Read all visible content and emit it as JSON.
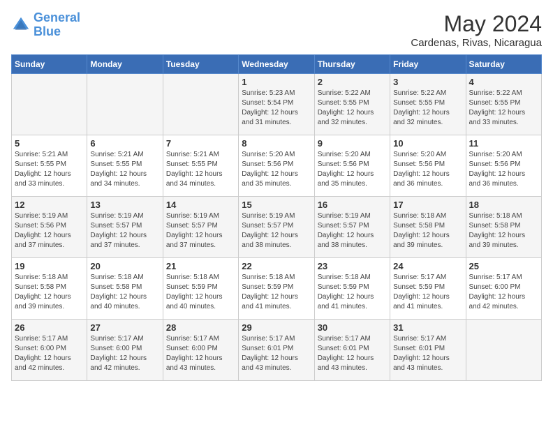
{
  "header": {
    "logo_general": "General",
    "logo_blue": "Blue",
    "month": "May 2024",
    "location": "Cardenas, Rivas, Nicaragua"
  },
  "weekdays": [
    "Sunday",
    "Monday",
    "Tuesday",
    "Wednesday",
    "Thursday",
    "Friday",
    "Saturday"
  ],
  "weeks": [
    [
      {
        "day": "",
        "sunrise": "",
        "sunset": "",
        "daylight": ""
      },
      {
        "day": "",
        "sunrise": "",
        "sunset": "",
        "daylight": ""
      },
      {
        "day": "",
        "sunrise": "",
        "sunset": "",
        "daylight": ""
      },
      {
        "day": "1",
        "sunrise": "Sunrise: 5:23 AM",
        "sunset": "Sunset: 5:54 PM",
        "daylight": "Daylight: 12 hours and 31 minutes."
      },
      {
        "day": "2",
        "sunrise": "Sunrise: 5:22 AM",
        "sunset": "Sunset: 5:55 PM",
        "daylight": "Daylight: 12 hours and 32 minutes."
      },
      {
        "day": "3",
        "sunrise": "Sunrise: 5:22 AM",
        "sunset": "Sunset: 5:55 PM",
        "daylight": "Daylight: 12 hours and 32 minutes."
      },
      {
        "day": "4",
        "sunrise": "Sunrise: 5:22 AM",
        "sunset": "Sunset: 5:55 PM",
        "daylight": "Daylight: 12 hours and 33 minutes."
      }
    ],
    [
      {
        "day": "5",
        "sunrise": "Sunrise: 5:21 AM",
        "sunset": "Sunset: 5:55 PM",
        "daylight": "Daylight: 12 hours and 33 minutes."
      },
      {
        "day": "6",
        "sunrise": "Sunrise: 5:21 AM",
        "sunset": "Sunset: 5:55 PM",
        "daylight": "Daylight: 12 hours and 34 minutes."
      },
      {
        "day": "7",
        "sunrise": "Sunrise: 5:21 AM",
        "sunset": "Sunset: 5:55 PM",
        "daylight": "Daylight: 12 hours and 34 minutes."
      },
      {
        "day": "8",
        "sunrise": "Sunrise: 5:20 AM",
        "sunset": "Sunset: 5:56 PM",
        "daylight": "Daylight: 12 hours and 35 minutes."
      },
      {
        "day": "9",
        "sunrise": "Sunrise: 5:20 AM",
        "sunset": "Sunset: 5:56 PM",
        "daylight": "Daylight: 12 hours and 35 minutes."
      },
      {
        "day": "10",
        "sunrise": "Sunrise: 5:20 AM",
        "sunset": "Sunset: 5:56 PM",
        "daylight": "Daylight: 12 hours and 36 minutes."
      },
      {
        "day": "11",
        "sunrise": "Sunrise: 5:20 AM",
        "sunset": "Sunset: 5:56 PM",
        "daylight": "Daylight: 12 hours and 36 minutes."
      }
    ],
    [
      {
        "day": "12",
        "sunrise": "Sunrise: 5:19 AM",
        "sunset": "Sunset: 5:56 PM",
        "daylight": "Daylight: 12 hours and 37 minutes."
      },
      {
        "day": "13",
        "sunrise": "Sunrise: 5:19 AM",
        "sunset": "Sunset: 5:57 PM",
        "daylight": "Daylight: 12 hours and 37 minutes."
      },
      {
        "day": "14",
        "sunrise": "Sunrise: 5:19 AM",
        "sunset": "Sunset: 5:57 PM",
        "daylight": "Daylight: 12 hours and 37 minutes."
      },
      {
        "day": "15",
        "sunrise": "Sunrise: 5:19 AM",
        "sunset": "Sunset: 5:57 PM",
        "daylight": "Daylight: 12 hours and 38 minutes."
      },
      {
        "day": "16",
        "sunrise": "Sunrise: 5:19 AM",
        "sunset": "Sunset: 5:57 PM",
        "daylight": "Daylight: 12 hours and 38 minutes."
      },
      {
        "day": "17",
        "sunrise": "Sunrise: 5:18 AM",
        "sunset": "Sunset: 5:58 PM",
        "daylight": "Daylight: 12 hours and 39 minutes."
      },
      {
        "day": "18",
        "sunrise": "Sunrise: 5:18 AM",
        "sunset": "Sunset: 5:58 PM",
        "daylight": "Daylight: 12 hours and 39 minutes."
      }
    ],
    [
      {
        "day": "19",
        "sunrise": "Sunrise: 5:18 AM",
        "sunset": "Sunset: 5:58 PM",
        "daylight": "Daylight: 12 hours and 39 minutes."
      },
      {
        "day": "20",
        "sunrise": "Sunrise: 5:18 AM",
        "sunset": "Sunset: 5:58 PM",
        "daylight": "Daylight: 12 hours and 40 minutes."
      },
      {
        "day": "21",
        "sunrise": "Sunrise: 5:18 AM",
        "sunset": "Sunset: 5:59 PM",
        "daylight": "Daylight: 12 hours and 40 minutes."
      },
      {
        "day": "22",
        "sunrise": "Sunrise: 5:18 AM",
        "sunset": "Sunset: 5:59 PM",
        "daylight": "Daylight: 12 hours and 41 minutes."
      },
      {
        "day": "23",
        "sunrise": "Sunrise: 5:18 AM",
        "sunset": "Sunset: 5:59 PM",
        "daylight": "Daylight: 12 hours and 41 minutes."
      },
      {
        "day": "24",
        "sunrise": "Sunrise: 5:17 AM",
        "sunset": "Sunset: 5:59 PM",
        "daylight": "Daylight: 12 hours and 41 minutes."
      },
      {
        "day": "25",
        "sunrise": "Sunrise: 5:17 AM",
        "sunset": "Sunset: 6:00 PM",
        "daylight": "Daylight: 12 hours and 42 minutes."
      }
    ],
    [
      {
        "day": "26",
        "sunrise": "Sunrise: 5:17 AM",
        "sunset": "Sunset: 6:00 PM",
        "daylight": "Daylight: 12 hours and 42 minutes."
      },
      {
        "day": "27",
        "sunrise": "Sunrise: 5:17 AM",
        "sunset": "Sunset: 6:00 PM",
        "daylight": "Daylight: 12 hours and 42 minutes."
      },
      {
        "day": "28",
        "sunrise": "Sunrise: 5:17 AM",
        "sunset": "Sunset: 6:00 PM",
        "daylight": "Daylight: 12 hours and 43 minutes."
      },
      {
        "day": "29",
        "sunrise": "Sunrise: 5:17 AM",
        "sunset": "Sunset: 6:01 PM",
        "daylight": "Daylight: 12 hours and 43 minutes."
      },
      {
        "day": "30",
        "sunrise": "Sunrise: 5:17 AM",
        "sunset": "Sunset: 6:01 PM",
        "daylight": "Daylight: 12 hours and 43 minutes."
      },
      {
        "day": "31",
        "sunrise": "Sunrise: 5:17 AM",
        "sunset": "Sunset: 6:01 PM",
        "daylight": "Daylight: 12 hours and 43 minutes."
      },
      {
        "day": "",
        "sunrise": "",
        "sunset": "",
        "daylight": ""
      }
    ]
  ]
}
